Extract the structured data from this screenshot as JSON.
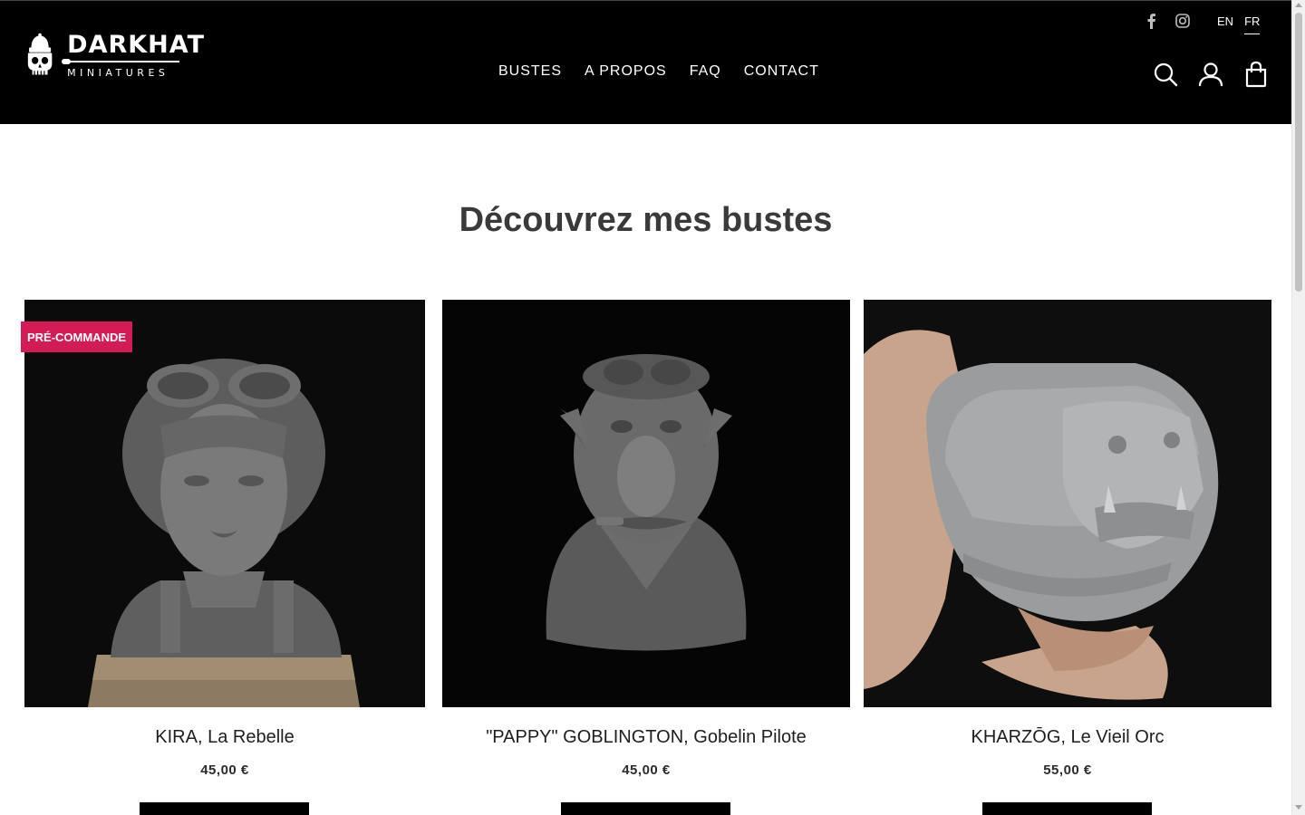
{
  "brand": {
    "title": "DARKHAT",
    "subtitle": "MINIATURES"
  },
  "nav": {
    "items": [
      "BUSTES",
      "A PROPOS",
      "FAQ",
      "CONTACT"
    ]
  },
  "social": {
    "icons": [
      "facebook-icon",
      "instagram-icon"
    ]
  },
  "language": {
    "options": [
      "EN",
      "FR"
    ],
    "selected": "FR"
  },
  "header_icons": [
    "search-icon",
    "account-icon",
    "cart-icon"
  ],
  "section": {
    "title": "Découvrez mes bustes"
  },
  "products": [
    {
      "name": "KIRA, La Rebelle",
      "price": "45,00 €",
      "badge": "PRÉ-COMMANDE"
    },
    {
      "name": "\"PAPPY\" GOBLINGTON, Gobelin Pilote",
      "price": "45,00 €"
    },
    {
      "name": "KHARZŌG, Le Vieil Orc",
      "price": "55,00 €"
    }
  ],
  "colors": {
    "header_bg": "#000000",
    "badge": "#d31b56",
    "title_text": "#3a3a3a"
  }
}
